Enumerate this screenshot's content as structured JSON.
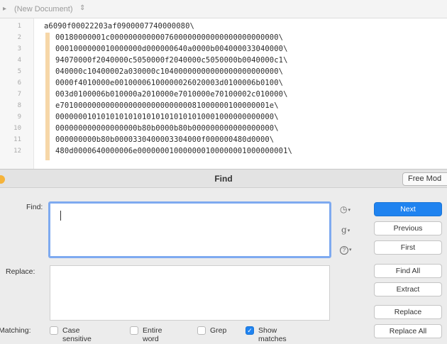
{
  "document": {
    "title": "(New Document)",
    "title_arrows": "⇕",
    "line_numbers": [
      "1",
      "2",
      "3",
      "4",
      "5",
      "6",
      "7",
      "8",
      "9",
      "10",
      "11",
      "12"
    ],
    "lines": [
      "a6090f00022203af0900007740000080\\",
      "00180000001c0000000000007600000000000000000000000\\",
      "0001000000010000000d000000640a0000b004000033040000\\",
      "94070000f2040000c5050000f2040000c5050000b0040000c1\\",
      "040000c10400002a030000c10400000000000000000000000\\",
      "0000f4010000e00100006100000026020003d0100006b0100\\",
      "003d0100006b010000a2010000e7010000e70100002c010000\\",
      "e7010000000000000000000000000081000000100000001e\\",
      "000000010101010101010101010101010001000000000000\\",
      "000000000000000000b80b0000b80b000000000000000000\\",
      "000000000b80b0000330400003304000f000000480d0000\\",
      "480d0000640000006e000000010000000100000001000000001\\"
    ]
  },
  "find_dialog": {
    "title": "Find",
    "free_mode_label": "Free Mod",
    "find_label": "Find:",
    "replace_label": "Replace:",
    "matching_label": "Matching:",
    "find_value": "",
    "replace_value": "",
    "side_icons": [
      "clock-history-icon",
      "grep-pattern-icon",
      "help-icon"
    ],
    "side_icon_glyphs": [
      "◷",
      "g",
      "?"
    ],
    "buttons": {
      "next": "Next",
      "previous": "Previous",
      "first": "First",
      "find_all": "Find All",
      "extract": "Extract",
      "replace": "Replace",
      "replace_all": "Replace All"
    },
    "options": {
      "case_sensitive": {
        "label": "Case sensitive",
        "checked": false
      },
      "entire_word": {
        "label": "Entire word",
        "checked": false
      },
      "grep": {
        "label": "Grep",
        "checked": false
      },
      "show_matches": {
        "label": "Show matches",
        "checked": true
      }
    },
    "colors": {
      "accent": "#1f83f0",
      "focus_ring": "#7eaaf0",
      "fold_highlight": "#f6d7a8"
    }
  }
}
